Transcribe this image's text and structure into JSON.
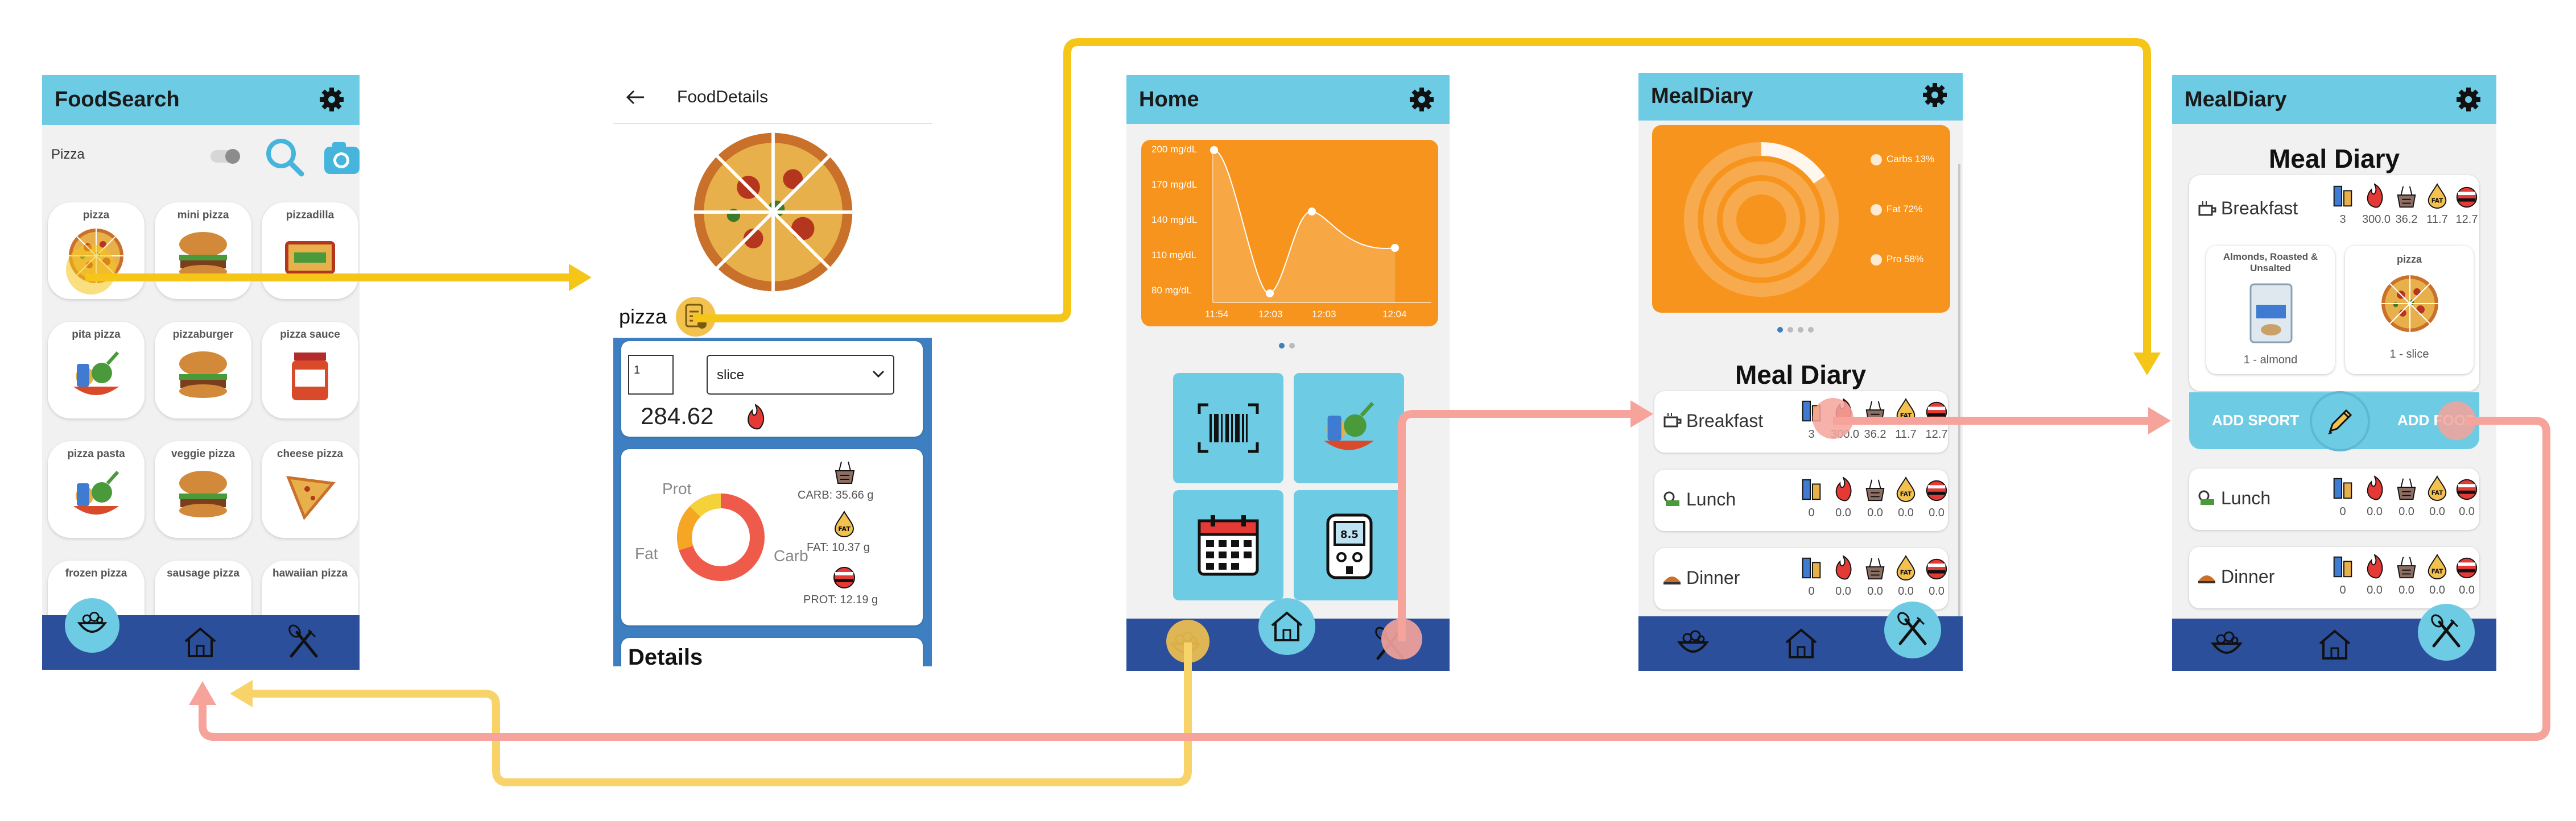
{
  "screens": {
    "foodsearch": {
      "title": "FoodSearch",
      "search_value": "Pizza",
      "tiles": [
        {
          "label": "pizza"
        },
        {
          "label": "mini pizza"
        },
        {
          "label": "pizzadilla"
        },
        {
          "label": "pita pizza"
        },
        {
          "label": "pizzaburger"
        },
        {
          "label": "pizza sauce"
        },
        {
          "label": "pizza pasta"
        },
        {
          "label": "veggie pizza"
        },
        {
          "label": "cheese pizza"
        },
        {
          "label": "frozen pizza"
        },
        {
          "label": "sausage pizza"
        },
        {
          "label": "hawaiian pizza"
        }
      ]
    },
    "fooddetails": {
      "title": "FoodDetails",
      "food_name": "pizza",
      "quantity_value": "1",
      "unit_value": "slice",
      "calories": "284.62",
      "donut_labels": {
        "prot": "Prot",
        "fat": "Fat",
        "carb": "Carb"
      },
      "macros": {
        "carb": "CARB: 35.66 g",
        "fat": "FAT: 10.37 g",
        "prot": "PROT: 12.19 g"
      },
      "details_heading": "Details"
    },
    "home": {
      "title": "Home",
      "chart": {
        "y_ticks": [
          "200 mg/dL",
          "170 mg/dL",
          "140 mg/dL",
          "110 mg/dL",
          "80 mg/dL"
        ],
        "x_ticks": [
          "11:54",
          "12:03",
          "12:03",
          "12:04"
        ]
      }
    },
    "mealdiary1": {
      "title": "MealDiary",
      "legend": [
        "Carbs 13%",
        "Fat 72%",
        "Pro 58%"
      ],
      "heading": "Meal Diary",
      "meals": [
        {
          "name": "Breakfast",
          "values": [
            "3",
            "300.0",
            "36.2",
            "11.7",
            "12.7"
          ]
        },
        {
          "name": "Lunch",
          "values": [
            "0",
            "0.0",
            "0.0",
            "0.0",
            "0.0"
          ]
        },
        {
          "name": "Dinner",
          "values": [
            "0",
            "0.0",
            "0.0",
            "0.0",
            "0.0"
          ]
        }
      ]
    },
    "mealdiary2": {
      "title": "MealDiary",
      "heading": "Meal Diary",
      "breakfast": {
        "name": "Breakfast",
        "values": [
          "3",
          "300.0",
          "36.2",
          "11.7",
          "12.7"
        ]
      },
      "foods": [
        {
          "name": "Almonds, Roasted & Unsalted",
          "qty": "1 - almond"
        },
        {
          "name": "pizza",
          "qty": "1 - slice"
        }
      ],
      "add_sport": "ADD SPORT",
      "add_food": "ADD FOOD",
      "meals": [
        {
          "name": "Lunch",
          "values": [
            "0",
            "0.0",
            "0.0",
            "0.0",
            "0.0"
          ]
        },
        {
          "name": "Dinner",
          "values": [
            "0",
            "0.0",
            "0.0",
            "0.0",
            "0.0"
          ]
        }
      ]
    }
  },
  "colors": {
    "topbar": "#6ecbe4",
    "bottombar": "#2c4f9c",
    "arrow_yellow": "#f5c518",
    "arrow_yellow_light": "#f7d36a",
    "arrow_pink": "#f5a39b",
    "orange": "#f7941d"
  }
}
